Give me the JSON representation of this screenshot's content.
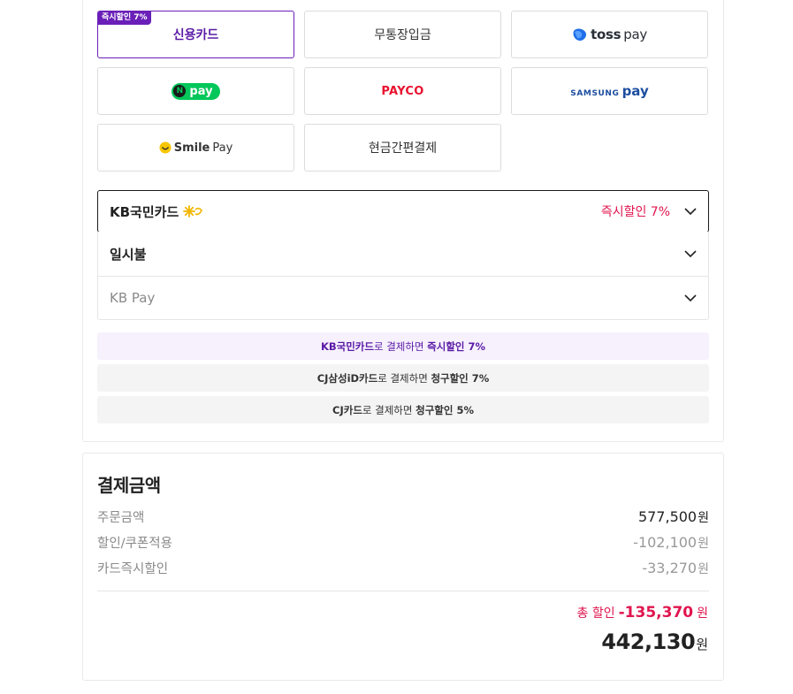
{
  "payment_methods": {
    "credit_card": {
      "label": "신용카드",
      "promo": "즉시할인 7%"
    },
    "bank_transfer": {
      "label": "무통장입금"
    },
    "toss": {
      "brand": "toss",
      "pay": "pay",
      "icon": "toss-icon"
    },
    "npay": {
      "mark": "N",
      "pay": "pay"
    },
    "payco": {
      "label": "PAYCO"
    },
    "samsung": {
      "brand": "SAMSUNG",
      "pay": "pay"
    },
    "smilepay": {
      "brand": "Smile",
      "pay": "Pay",
      "icon": "smile-icon"
    },
    "simple_cash": {
      "label": "현금간편결제"
    }
  },
  "card_select": {
    "label": "KB국민카드",
    "discount": "즉시할인 7%",
    "icon": "kb-star-icon"
  },
  "installment_select": {
    "label": "일시불"
  },
  "kbpay_select": {
    "label": "KB Pay"
  },
  "notices": [
    {
      "card": "KB국민카드",
      "middle": "로 결제하면 ",
      "benefit": "즉시할인 7%"
    },
    {
      "card": "CJ삼성iD카드",
      "middle": "로 결제하면 ",
      "benefit": "청구할인 7%"
    },
    {
      "card": "CJ카드",
      "middle": "로 결제하면 ",
      "benefit": "청구할인 5%"
    }
  ],
  "summary": {
    "title": "결제금액",
    "order_amount_label": "주문금액",
    "order_amount": "577,500",
    "coupon_label": "할인/쿠폰적용",
    "coupon_amount": "-102,100",
    "card_discount_label": "카드즉시할인",
    "card_discount_amount": "-33,270",
    "total_discount_label": "총 할인",
    "total_discount_amount": "-135,370",
    "grand_total": "442,130",
    "currency": "원"
  },
  "colors": {
    "accent": "#6a1fb8",
    "discount": "#e0154e",
    "npay": "#03c75a",
    "payco": "#e8122f",
    "samsung": "#1d4ea0",
    "toss": "#1f6fe8"
  }
}
